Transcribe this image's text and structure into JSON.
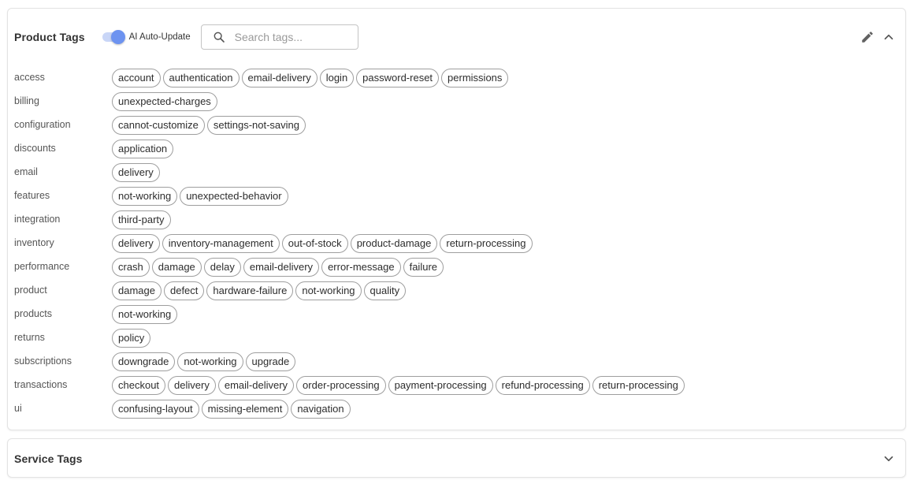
{
  "product_tags": {
    "title": "Product Tags",
    "ai_toggle": {
      "label": "AI Auto-Update",
      "on": true
    },
    "search": {
      "placeholder": "Search tags...",
      "value": ""
    },
    "colors": {
      "toggle_track": "#c9d6f7",
      "toggle_thumb": "#6d93f0",
      "chip_border": "#9e9e9e"
    },
    "rows": [
      {
        "category": "access",
        "tags": [
          "account",
          "authentication",
          "email-delivery",
          "login",
          "password-reset",
          "permissions"
        ]
      },
      {
        "category": "billing",
        "tags": [
          "unexpected-charges"
        ]
      },
      {
        "category": "configuration",
        "tags": [
          "cannot-customize",
          "settings-not-saving"
        ]
      },
      {
        "category": "discounts",
        "tags": [
          "application"
        ]
      },
      {
        "category": "email",
        "tags": [
          "delivery"
        ]
      },
      {
        "category": "features",
        "tags": [
          "not-working",
          "unexpected-behavior"
        ]
      },
      {
        "category": "integration",
        "tags": [
          "third-party"
        ]
      },
      {
        "category": "inventory",
        "tags": [
          "delivery",
          "inventory-management",
          "out-of-stock",
          "product-damage",
          "return-processing"
        ]
      },
      {
        "category": "performance",
        "tags": [
          "crash",
          "damage",
          "delay",
          "email-delivery",
          "error-message",
          "failure"
        ]
      },
      {
        "category": "product",
        "tags": [
          "damage",
          "defect",
          "hardware-failure",
          "not-working",
          "quality"
        ]
      },
      {
        "category": "products",
        "tags": [
          "not-working"
        ]
      },
      {
        "category": "returns",
        "tags": [
          "policy"
        ]
      },
      {
        "category": "subscriptions",
        "tags": [
          "downgrade",
          "not-working",
          "upgrade"
        ]
      },
      {
        "category": "transactions",
        "tags": [
          "checkout",
          "delivery",
          "email-delivery",
          "order-processing",
          "payment-processing",
          "refund-processing",
          "return-processing"
        ]
      },
      {
        "category": "ui",
        "tags": [
          "confusing-layout",
          "missing-element",
          "navigation"
        ]
      }
    ],
    "icons": {
      "edit": "pencil-icon",
      "collapse": "chevron-up-icon"
    }
  },
  "service_tags": {
    "title": "Service Tags",
    "icons": {
      "expand": "chevron-down-icon"
    }
  }
}
